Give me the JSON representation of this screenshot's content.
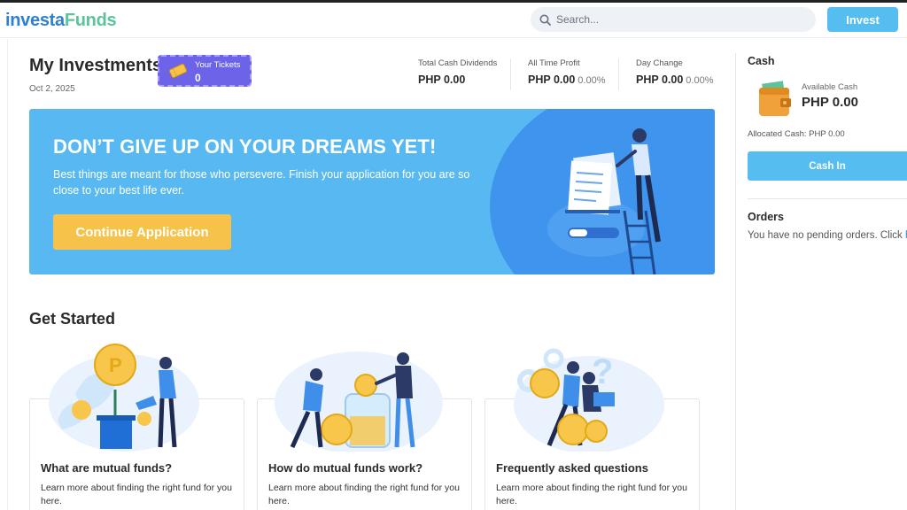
{
  "brand": {
    "logo_part1": "investa",
    "logo_part2": "Funds"
  },
  "header": {
    "search_placeholder": "Search...",
    "invest_label": "Invest"
  },
  "summary": {
    "title": "My Investments",
    "date": "Oct 2, 2025",
    "tickets_label": "Your Tickets",
    "tickets_count": "0",
    "stats": [
      {
        "label": "Total Cash Dividends",
        "value": "PHP 0.00",
        "pct": ""
      },
      {
        "label": "All Time Profit",
        "value": "PHP 0.00",
        "pct": "0.00%"
      },
      {
        "label": "Day Change",
        "value": "PHP 0.00",
        "pct": "0.00%"
      }
    ]
  },
  "banner": {
    "title": "DON’T GIVE UP ON YOUR DREAMS YET!",
    "subtitle": "Best things are meant for those who persevere. Finish your application for you are so close to your best life ever.",
    "button_label": "Continue Application"
  },
  "get_started": {
    "title": "Get Started",
    "cards": [
      {
        "title": "What are mutual funds?",
        "description": "Learn more about finding the right fund for you here."
      },
      {
        "title": "How do mutual funds work?",
        "description": "Learn more about finding the right fund for you here."
      },
      {
        "title": "Frequently asked questions",
        "description": "Learn more about finding the right fund for you here."
      }
    ]
  },
  "cash": {
    "title": "Cash",
    "available_label": "Available Cash",
    "available_value": "PHP 0.00",
    "allocated": "Allocated Cash: PHP 0.00",
    "cash_in_label": "Cash In"
  },
  "orders": {
    "title": "Orders",
    "text": "You have no pending orders. Click ",
    "link": "h"
  },
  "colors": {
    "accent": "#56bdf1",
    "banner": "#58b8f2",
    "button_yellow": "#f6c24a",
    "tickets": "#6c63e8"
  }
}
